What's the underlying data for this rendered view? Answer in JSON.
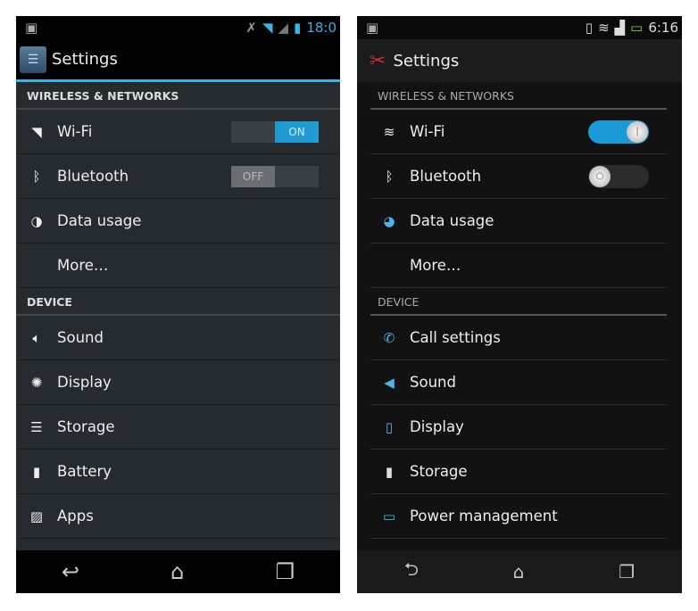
{
  "left": {
    "status": {
      "time": "18:0",
      "icons": [
        "image-icon",
        "mute-icon",
        "wifi-icon",
        "signal-icon",
        "battery-icon"
      ]
    },
    "title": "Settings",
    "sections": [
      {
        "header": "WIRELESS & NETWORKS",
        "items": [
          {
            "label": "Wi-Fi",
            "icon": "wifi-icon",
            "toggle": "ON"
          },
          {
            "label": "Bluetooth",
            "icon": "bluetooth-icon",
            "toggle": "OFF"
          },
          {
            "label": "Data usage",
            "icon": "data-usage-icon"
          },
          {
            "label": "More…"
          }
        ]
      },
      {
        "header": "DEVICE",
        "items": [
          {
            "label": "Sound",
            "icon": "sound-icon"
          },
          {
            "label": "Display",
            "icon": "display-icon"
          },
          {
            "label": "Storage",
            "icon": "storage-icon"
          },
          {
            "label": "Battery",
            "icon": "battery-icon"
          },
          {
            "label": "Apps",
            "icon": "apps-icon"
          }
        ]
      }
    ],
    "accent": "#33b5e5"
  },
  "right": {
    "status": {
      "time": "6:16",
      "icons": [
        "image-icon",
        "vibrate-icon",
        "wifi-icon",
        "signal-icon",
        "battery-icon"
      ]
    },
    "title": "Settings",
    "sections": [
      {
        "header": "WIRELESS & NETWORKS",
        "items": [
          {
            "label": "Wi-Fi",
            "icon": "wifi-icon",
            "toggle": "on"
          },
          {
            "label": "Bluetooth",
            "icon": "bluetooth-icon",
            "toggle": "off"
          },
          {
            "label": "Data usage",
            "icon": "data-usage-icon"
          },
          {
            "label": "More…"
          }
        ]
      },
      {
        "header": "DEVICE",
        "items": [
          {
            "label": "Call settings",
            "icon": "phone-icon"
          },
          {
            "label": "Sound",
            "icon": "sound-icon"
          },
          {
            "label": "Display",
            "icon": "display-icon"
          },
          {
            "label": "Storage",
            "icon": "storage-icon"
          },
          {
            "label": "Power management",
            "icon": "power-icon"
          }
        ]
      }
    ],
    "accent": "#1a9ad6"
  }
}
